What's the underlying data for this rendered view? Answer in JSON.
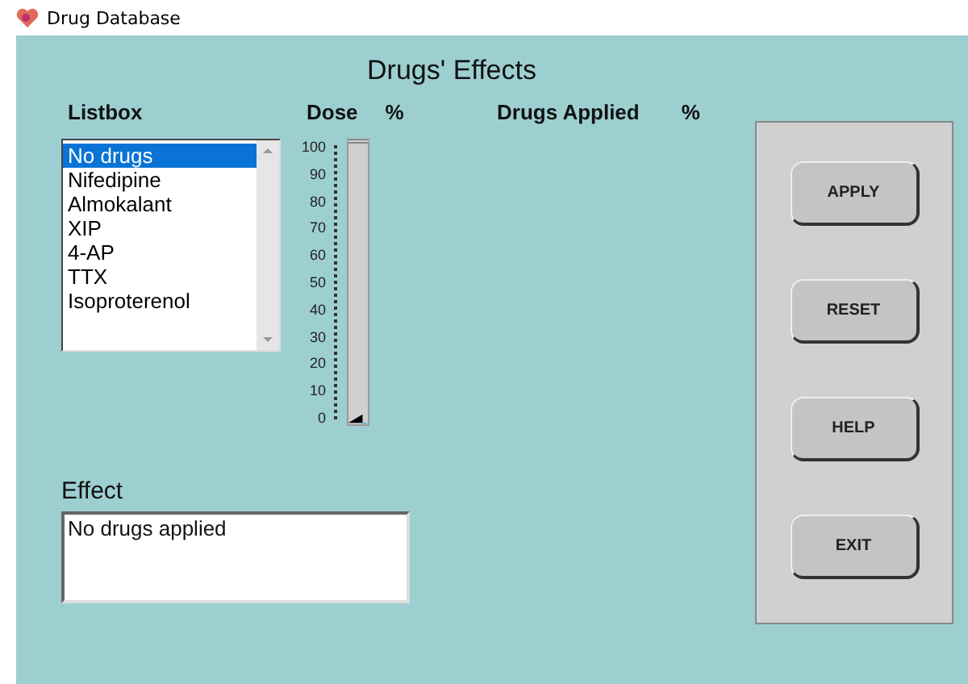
{
  "window": {
    "title": "Drug Database"
  },
  "heading": "Drugs' Effects",
  "listbox": {
    "label": "Listbox",
    "items": [
      {
        "label": "No drugs",
        "selected": true
      },
      {
        "label": "Nifedipine",
        "selected": false
      },
      {
        "label": "Almokalant",
        "selected": false
      },
      {
        "label": "XIP",
        "selected": false
      },
      {
        "label": "4-AP",
        "selected": false
      },
      {
        "label": "TTX",
        "selected": false
      },
      {
        "label": "Isoproterenol",
        "selected": false
      }
    ]
  },
  "dose": {
    "label": "Dose",
    "unit": "%",
    "level": 0,
    "ticks": [
      "100",
      "90",
      "80",
      "70",
      "60",
      "50",
      "40",
      "30",
      "20",
      "10",
      "0"
    ]
  },
  "applied": {
    "label": "Drugs Applied",
    "unit": "%"
  },
  "effect": {
    "label": "Effect",
    "value": "No drugs applied"
  },
  "buttons": [
    "APPLY",
    "RESET",
    "HELP",
    "EXIT"
  ]
}
